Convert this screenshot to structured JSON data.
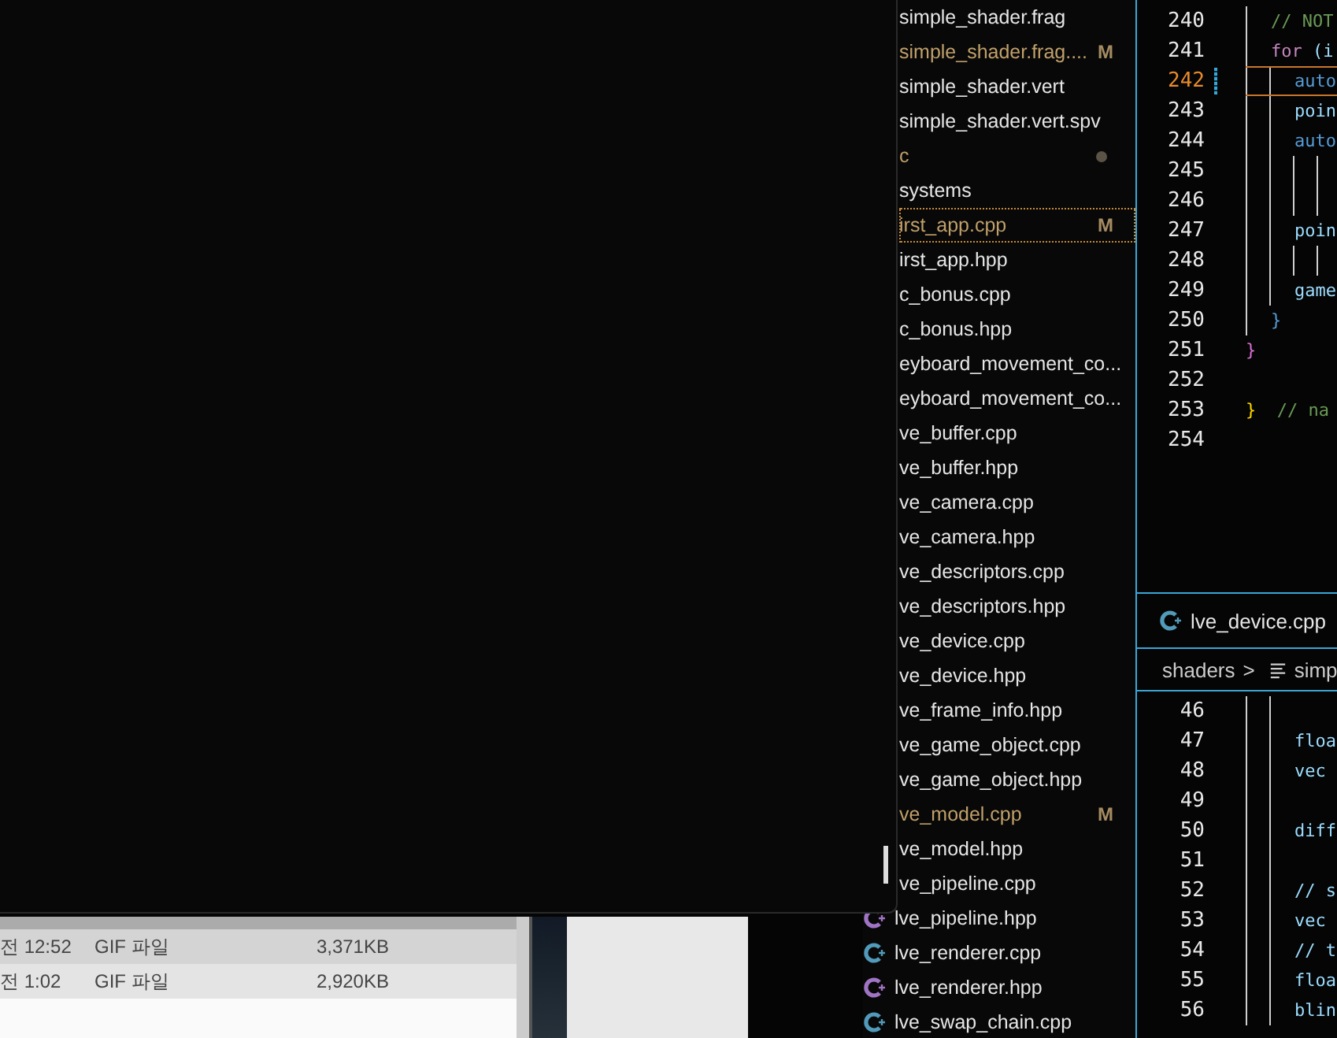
{
  "file_explorer": {
    "rows": [
      {
        "time": "전 12:52",
        "type": "GIF 파일",
        "size": "3,371KB"
      },
      {
        "time": "전 1:02",
        "type": "GIF 파일",
        "size": "2,920KB"
      }
    ]
  },
  "sidebar": {
    "items": [
      {
        "label": "simple_shader.frag",
        "kind": "covered",
        "modified": false,
        "focused": false
      },
      {
        "label": "simple_shader.frag....",
        "kind": "covered",
        "modified": true,
        "badge": "M",
        "focused": false
      },
      {
        "label": "simple_shader.vert",
        "kind": "covered",
        "modified": false,
        "focused": false
      },
      {
        "label": "simple_shader.vert.spv",
        "kind": "covered",
        "modified": false,
        "focused": false
      },
      {
        "label": "c",
        "kind": "covered",
        "modified": true,
        "dot": true,
        "focused": false
      },
      {
        "label": "systems",
        "kind": "covered",
        "modified": false,
        "focused": false
      },
      {
        "label": "irst_app.cpp",
        "kind": "covered",
        "modified": true,
        "badge": "M",
        "focused": true
      },
      {
        "label": "irst_app.hpp",
        "kind": "covered",
        "modified": false,
        "focused": false
      },
      {
        "label": "c_bonus.cpp",
        "kind": "covered",
        "modified": false,
        "focused": false
      },
      {
        "label": "c_bonus.hpp",
        "kind": "covered",
        "modified": false,
        "focused": false
      },
      {
        "label": "eyboard_movement_co...",
        "kind": "covered",
        "modified": false,
        "focused": false
      },
      {
        "label": "eyboard_movement_co...",
        "kind": "covered",
        "modified": false,
        "focused": false
      },
      {
        "label": "ve_buffer.cpp",
        "kind": "covered",
        "modified": false,
        "focused": false
      },
      {
        "label": "ve_buffer.hpp",
        "kind": "covered",
        "modified": false,
        "focused": false
      },
      {
        "label": "ve_camera.cpp",
        "kind": "covered",
        "modified": false,
        "focused": false
      },
      {
        "label": "ve_camera.hpp",
        "kind": "covered",
        "modified": false,
        "focused": false
      },
      {
        "label": "ve_descriptors.cpp",
        "kind": "covered",
        "modified": false,
        "focused": false
      },
      {
        "label": "ve_descriptors.hpp",
        "kind": "covered",
        "modified": false,
        "focused": false
      },
      {
        "label": "ve_device.cpp",
        "kind": "covered",
        "modified": false,
        "focused": false
      },
      {
        "label": "ve_device.hpp",
        "kind": "covered",
        "modified": false,
        "focused": false
      },
      {
        "label": "ve_frame_info.hpp",
        "kind": "covered",
        "modified": false,
        "focused": false
      },
      {
        "label": "ve_game_object.cpp",
        "kind": "covered",
        "modified": false,
        "focused": false
      },
      {
        "label": "ve_game_object.hpp",
        "kind": "covered",
        "modified": false,
        "focused": false
      },
      {
        "label": "ve_model.cpp",
        "kind": "covered",
        "modified": true,
        "badge": "M",
        "focused": false
      },
      {
        "label": "ve_model.hpp",
        "kind": "covered",
        "modified": false,
        "focused": false
      },
      {
        "label": "ve_pipeline.cpp",
        "kind": "covered",
        "modified": false,
        "focused": false
      },
      {
        "label": "lve_pipeline.hpp",
        "kind": "hpp",
        "modified": false,
        "focused": false
      },
      {
        "label": "lve_renderer.cpp",
        "kind": "cpp",
        "modified": false,
        "focused": false
      },
      {
        "label": "lve_renderer.hpp",
        "kind": "hpp",
        "modified": false,
        "focused": false
      },
      {
        "label": "lve_swap_chain.cpp",
        "kind": "cpp",
        "modified": false,
        "focused": false
      }
    ]
  },
  "editor_top": {
    "lines": [
      {
        "number": "240",
        "current": false,
        "kind": "loop",
        "tokens": [
          {
            "text": "// NOT",
            "kind": "comment"
          }
        ]
      },
      {
        "number": "241",
        "current": false,
        "kind": "loop",
        "tokens": [
          {
            "text": "for",
            "kind": "keyword"
          },
          {
            "text": " (i",
            "kind": "code"
          }
        ]
      },
      {
        "number": "242",
        "current": true,
        "kind": "body",
        "tokens": [
          {
            "text": "auto",
            "kind": "type"
          }
        ]
      },
      {
        "number": "243",
        "current": false,
        "kind": "body",
        "tokens": [
          {
            "text": "poin",
            "kind": "code"
          }
        ]
      },
      {
        "number": "244",
        "current": false,
        "kind": "body",
        "tokens": [
          {
            "text": "auto",
            "kind": "type"
          }
        ]
      },
      {
        "number": "245",
        "current": false,
        "kind": "wrapped"
      },
      {
        "number": "246",
        "current": false,
        "kind": "wrapped"
      },
      {
        "number": "247",
        "current": false,
        "kind": "body",
        "tokens": [
          {
            "text": "poin",
            "kind": "code"
          }
        ]
      },
      {
        "number": "248",
        "current": false,
        "kind": "wrapped"
      },
      {
        "number": "249",
        "current": false,
        "kind": "body",
        "tokens": [
          {
            "text": "game",
            "kind": "code"
          }
        ]
      },
      {
        "number": "250",
        "current": false,
        "kind": "loop",
        "tokens": [
          {
            "text": "}",
            "kind": "brace"
          }
        ]
      },
      {
        "number": "251",
        "current": false,
        "kind": "top",
        "tokens": [
          {
            "text": "}",
            "kind": "brace2"
          }
        ]
      },
      {
        "number": "252",
        "current": false,
        "kind": "top"
      },
      {
        "number": "253",
        "current": false,
        "kind": "top",
        "tokens": [
          {
            "text": "}",
            "kind": "brace3"
          },
          {
            "text": "  // na",
            "kind": "comment"
          }
        ]
      },
      {
        "number": "254",
        "current": false,
        "kind": "top"
      }
    ]
  },
  "editor_bottom": {
    "tab": {
      "label": "lve_device.cpp",
      "kind": "cpp"
    },
    "breadcrumb": {
      "folder": "shaders",
      "separator": ">",
      "file": "simp"
    },
    "lines": [
      {
        "number": "46"
      },
      {
        "number": "47",
        "tokens": [
          {
            "text": "floa",
            "kind": "code"
          }
        ]
      },
      {
        "number": "48",
        "tokens": [
          {
            "text": "vec",
            "kind": "code"
          }
        ]
      },
      {
        "number": "49"
      },
      {
        "number": "50",
        "tokens": [
          {
            "text": "diff",
            "kind": "code"
          }
        ]
      },
      {
        "number": "51"
      },
      {
        "number": "52",
        "tokens": [
          {
            "text": "// s",
            "kind": "code"
          }
        ]
      },
      {
        "number": "53",
        "tokens": [
          {
            "text": "vec",
            "kind": "code"
          }
        ]
      },
      {
        "number": "54",
        "tokens": [
          {
            "text": "// t",
            "kind": "code"
          }
        ]
      },
      {
        "number": "55",
        "tokens": [
          {
            "text": "floa",
            "kind": "code"
          }
        ]
      },
      {
        "number": "56",
        "tokens": [
          {
            "text": "blin",
            "kind": "code"
          }
        ]
      }
    ]
  }
}
